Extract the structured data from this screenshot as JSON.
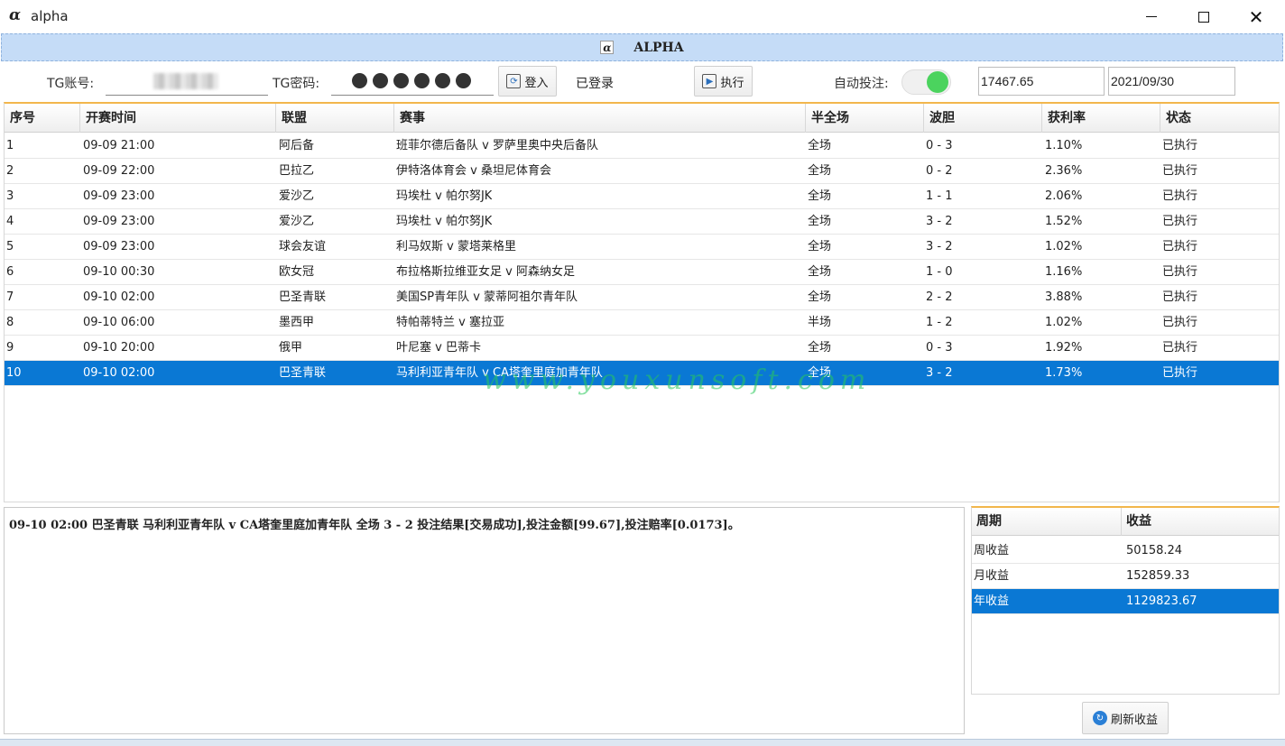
{
  "window": {
    "icon": "α",
    "title": "alpha"
  },
  "banner": {
    "icon": "α",
    "title": "ALPHA"
  },
  "toolbar": {
    "account_label": "TG账号:",
    "password_label": "TG密码:",
    "login_label": "登入",
    "login_status": "已登录",
    "execute_label": "执行",
    "auto_bet_label": "自动投注:",
    "auto_bet_on": true,
    "balance": "17467.65",
    "date": "2021/09/30"
  },
  "table": {
    "headers": [
      "序号",
      "开赛时间",
      "联盟",
      "赛事",
      "半全场",
      "波胆",
      "获利率",
      "状态"
    ],
    "rows": [
      [
        "1",
        "09-09 21:00",
        "阿后备",
        "班菲尔德后备队 v 罗萨里奥中央后备队",
        "全场",
        "0 - 3",
        "1.10%",
        "已执行"
      ],
      [
        "2",
        "09-09 22:00",
        "巴拉乙",
        "伊特洛体育会 v 桑坦尼体育会",
        "全场",
        "0 - 2",
        "2.36%",
        "已执行"
      ],
      [
        "3",
        "09-09 23:00",
        "爱沙乙",
        "玛埃杜 v 帕尔努JK",
        "全场",
        "1 - 1",
        "2.06%",
        "已执行"
      ],
      [
        "4",
        "09-09 23:00",
        "爱沙乙",
        "玛埃杜 v 帕尔努JK",
        "全场",
        "3 - 2",
        "1.52%",
        "已执行"
      ],
      [
        "5",
        "09-09 23:00",
        "球会友谊",
        "利马奴斯 v 蒙塔莱格里",
        "全场",
        "3 - 2",
        "1.02%",
        "已执行"
      ],
      [
        "6",
        "09-10 00:30",
        "欧女冠",
        "布拉格斯拉维亚女足 v 阿森纳女足",
        "全场",
        "1 - 0",
        "1.16%",
        "已执行"
      ],
      [
        "7",
        "09-10 02:00",
        "巴圣青联",
        "美国SP青年队 v 蒙蒂阿祖尔青年队",
        "全场",
        "2 - 2",
        "3.88%",
        "已执行"
      ],
      [
        "8",
        "09-10 06:00",
        "墨西甲",
        "特帕蒂特兰 v 塞拉亚",
        "半场",
        "1 - 2",
        "1.02%",
        "已执行"
      ],
      [
        "9",
        "09-10 20:00",
        "俄甲",
        "叶尼塞 v 巴蒂卡",
        "全场",
        "0 - 3",
        "1.92%",
        "已执行"
      ],
      [
        "10",
        "09-10 02:00",
        "巴圣青联",
        "马利利亚青年队 v CA塔奎里庭加青年队",
        "全场",
        "3 - 2",
        "1.73%",
        "已执行"
      ]
    ],
    "selected_row": 10
  },
  "watermark": "www.youxunsoft.com",
  "log": {
    "lines": [
      "09-10 02:00 巴圣青联 马利利亚青年队 v CA塔奎里庭加青年队 全场 3 - 2 投注结果[交易成功],投注金额[99.67],投注赔率[0.0173]。"
    ]
  },
  "profit": {
    "headers": [
      "周期",
      "收益"
    ],
    "rows": [
      [
        "周收益",
        "50158.24"
      ],
      [
        "月收益",
        "152859.33"
      ],
      [
        "年收益",
        "1129823.67"
      ]
    ],
    "selected_row": 3,
    "refresh_label": "刷新收益"
  },
  "colors": {
    "selection": "#0a78d4",
    "banner_bg": "#c5dcf7",
    "header_accent": "#f2b64c",
    "toggle_on": "#4bd35e"
  },
  "icons": {
    "login": "login-icon",
    "execute": "play-icon",
    "refresh": "refresh-icon"
  }
}
